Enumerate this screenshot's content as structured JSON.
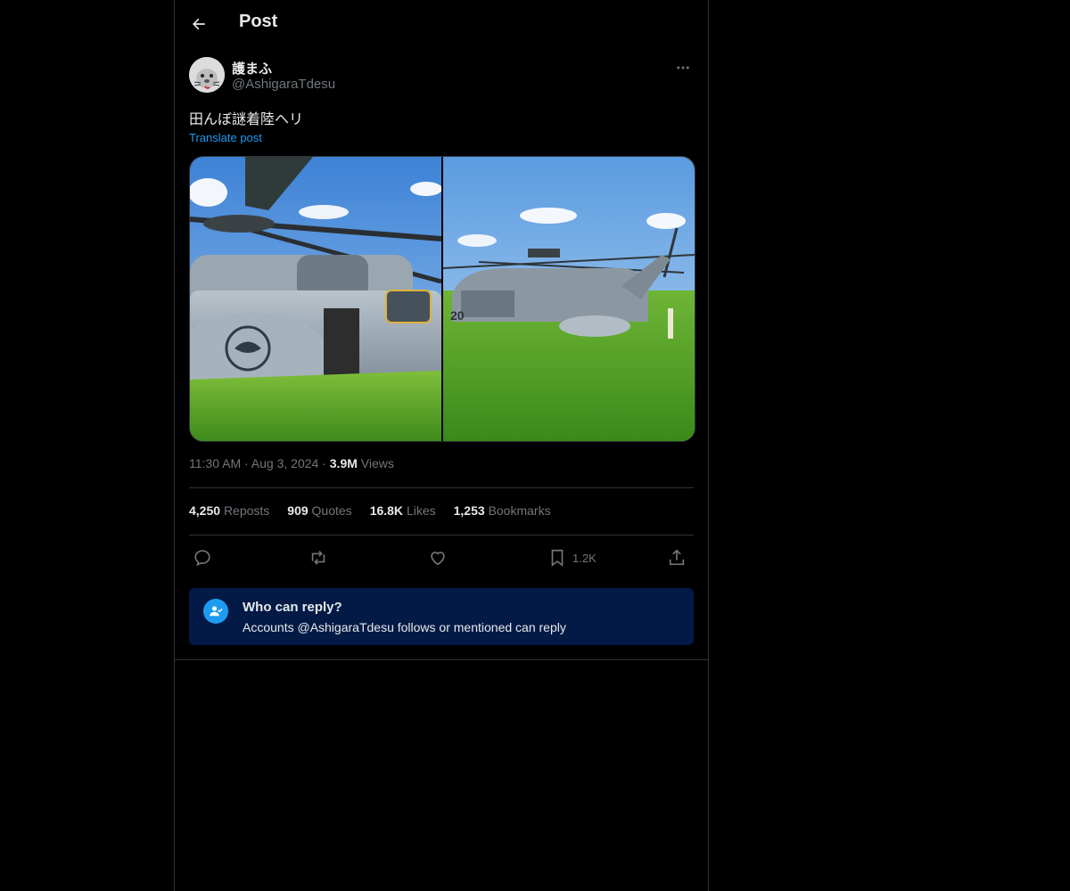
{
  "header": {
    "title": "Post"
  },
  "author": {
    "name": "護まふ",
    "handle": "@AshigaraTdesu"
  },
  "post": {
    "text": "田んぼ謎着陸ヘリ",
    "translate_label": "Translate post"
  },
  "media": {
    "image_count": 2
  },
  "meta": {
    "time": "11:30 AM",
    "date": "Aug 3, 2024",
    "views_count": "3.9M",
    "views_label": "Views"
  },
  "stats": [
    {
      "count": "4,250",
      "label": "Reposts"
    },
    {
      "count": "909",
      "label": "Quotes"
    },
    {
      "count": "16.8K",
      "label": "Likes"
    },
    {
      "count": "1,253",
      "label": "Bookmarks"
    }
  ],
  "actions": {
    "bookmark_count": "1.2K"
  },
  "who_can_reply": {
    "title": "Who can reply?",
    "subtitle": "Accounts @AshigaraTdesu follows or mentioned can reply"
  },
  "colors": {
    "accent": "#1d9bf0",
    "background": "#000000",
    "muted": "#71767b",
    "reply_box": "#031a46"
  }
}
